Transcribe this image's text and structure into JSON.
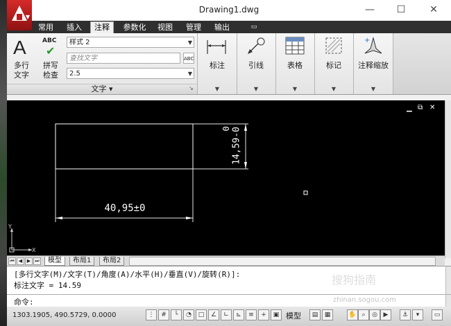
{
  "window": {
    "title": "Drawing1.dwg",
    "minimize": "—",
    "maximize": "☐",
    "close": "✕"
  },
  "ribbon_tabs": [
    "常用",
    "插入",
    "注释",
    "参数化",
    "视图",
    "管理",
    "输出"
  ],
  "active_tab": "注释",
  "tab_extra_icon": "▭",
  "text_panel": {
    "mtext_label_1": "多行",
    "mtext_label_2": "文字",
    "spell_abc": "ABC",
    "spell_label_1": "拼写",
    "spell_label_2": "检查",
    "style_value": "样式 2",
    "find_placeholder": "查找文字",
    "height_value": "2.5",
    "panel_title": "文字 ▾"
  },
  "ribbon_groups": [
    {
      "label": "标注"
    },
    {
      "label": "引线"
    },
    {
      "label": "表格"
    },
    {
      "label": "标记"
    },
    {
      "label": "注释缩放"
    }
  ],
  "drawing": {
    "horizontal_dimension": "40,95±0",
    "vertical_dimension": "14,59-0",
    "vertical_tolerance_top": "0",
    "ucs_y": "Y",
    "ucs_x": "X",
    "viewport_controls": [
      "▁",
      "⧉",
      "✕"
    ]
  },
  "layout_tabs": [
    "模型",
    "布局1",
    "布局2"
  ],
  "command": {
    "line1": "[多行文字(M)/文字(T)/角度(A)/水平(H)/垂直(V)/旋转(R)]:",
    "line2": "标注文字 = 14.59",
    "prompt": "命令:"
  },
  "status": {
    "coordinates": "1303.1905, 490.5729, 0.0000",
    "model_label": "模型"
  },
  "watermark": "搜狗指南",
  "watermark_url": "zhinan.sogou.com"
}
